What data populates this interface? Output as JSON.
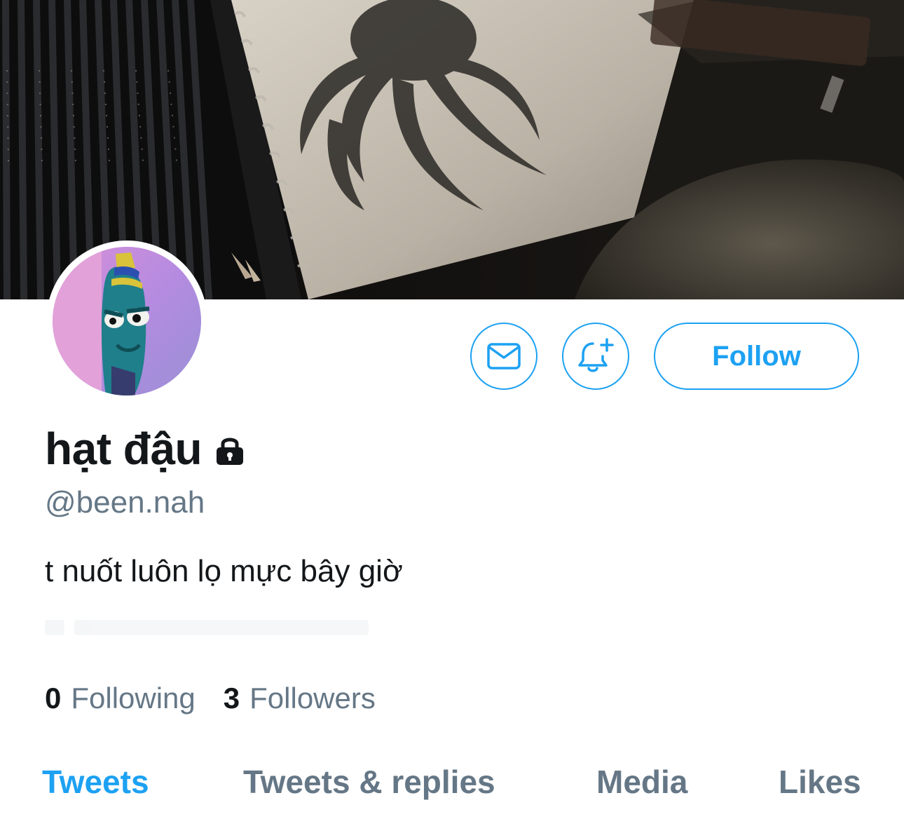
{
  "profile": {
    "display_name": "hạt đậu",
    "handle": "@been.nah",
    "bio": "t nuốt luôn lọ mực bây giờ",
    "protected_icon": "lock-icon"
  },
  "actions": {
    "message_icon": "envelope-icon",
    "notify_icon": "bell-plus-icon",
    "follow_label": "Follow"
  },
  "stats": {
    "following_count": "0",
    "following_label": "Following",
    "followers_count": "3",
    "followers_label": "Followers"
  },
  "tabs": [
    {
      "label": "Tweets",
      "active": true
    },
    {
      "label": "Tweets & replies",
      "active": false
    },
    {
      "label": "Media",
      "active": false
    },
    {
      "label": "Likes",
      "active": false
    }
  ],
  "colors": {
    "accent": "#1da1f2",
    "secondary_text": "#657786",
    "primary_text": "#14171a"
  }
}
